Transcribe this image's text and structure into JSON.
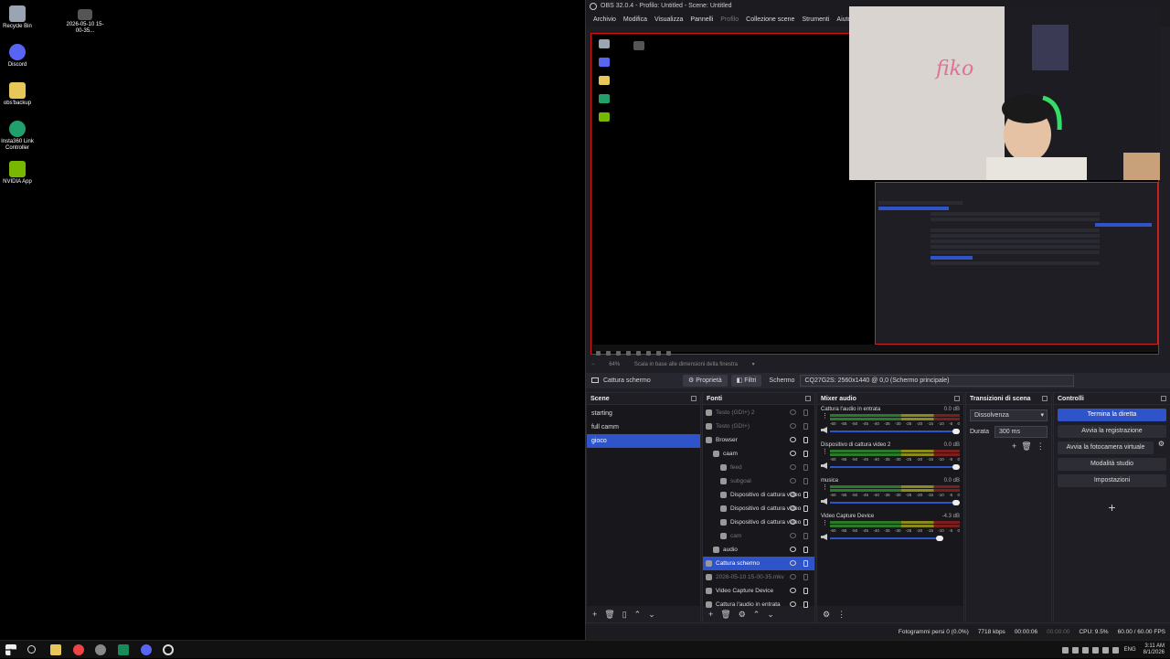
{
  "desktop": {
    "icons": [
      {
        "label": "Recycle Bin",
        "color": "#9aa4b2"
      },
      {
        "label": "Discord",
        "color": "#5865f2"
      },
      {
        "label": "obs'backup",
        "color": "#e8c75a"
      },
      {
        "label": "Insta360 Link Controller",
        "color": "#22a06b"
      },
      {
        "label": "NVIDIA App",
        "color": "#76b900"
      }
    ],
    "file_icon": {
      "label": "2026-05-10 15-00-35...",
      "color": "#555"
    }
  },
  "obs": {
    "title": "OBS 32.0.4 - Profilo: Untitled - Scene: Untitled",
    "menu": [
      "Archivio",
      "Modifica",
      "Visualizza",
      "Pannelli",
      "Profilo",
      "Collezione scene",
      "Strumenti",
      "Aiuto"
    ],
    "zoom": "64%",
    "zoom_mode": "Scala in base alle dimensioni della finestra",
    "source_bar": {
      "selected_source": "Cattura schermo",
      "properties": "Proprietà",
      "filters": "Filtri",
      "screen_label": "Schermo",
      "screen_value": "CQ27G2S: 2560x1440 @ 0,0 (Schermo principale)"
    },
    "scenes": {
      "title": "Scene",
      "items": [
        "starting",
        "full camm",
        "gioco"
      ]
    },
    "sources": {
      "title": "Fonti",
      "items": [
        {
          "label": "Testo (GDI+) 2",
          "indent": 0,
          "dim": true
        },
        {
          "label": "Testo (GDI+)",
          "indent": 0,
          "dim": true
        },
        {
          "label": "Browser",
          "indent": 0,
          "dim": false
        },
        {
          "label": "caam",
          "indent": 1,
          "dim": false
        },
        {
          "label": "feed",
          "indent": 2,
          "dim": true
        },
        {
          "label": "subgoal",
          "indent": 2,
          "dim": true
        },
        {
          "label": "Dispositivo di cattura video",
          "indent": 2,
          "dim": false
        },
        {
          "label": "Dispositivo di cattura video",
          "indent": 2,
          "dim": false
        },
        {
          "label": "Dispositivo di cattura video",
          "indent": 2,
          "dim": false
        },
        {
          "label": "cam",
          "indent": 2,
          "dim": true
        },
        {
          "label": "audio",
          "indent": 1,
          "dim": false
        },
        {
          "label": "Cattura schermo",
          "indent": 0,
          "dim": false
        },
        {
          "label": "2026-05-10 15-00-35.mkv",
          "indent": 0,
          "dim": true
        },
        {
          "label": "Video Capture Device",
          "indent": 0,
          "dim": false
        },
        {
          "label": "Cattura l'audio in entrata",
          "indent": 0,
          "dim": false
        }
      ]
    },
    "mixer": {
      "title": "Mixer audio",
      "ticks": [
        "-60",
        "-55",
        "-50",
        "-45",
        "-40",
        "-35",
        "-30",
        "-25",
        "-20",
        "-15",
        "-10",
        "-5",
        "0"
      ],
      "channels": [
        {
          "name": "Cattura l'audio in entrata",
          "db": "0.0 dB",
          "level": 1.0
        },
        {
          "name": "Dispositivo di cattura video 2",
          "db": "0.0 dB",
          "level": 1.0
        },
        {
          "name": "musica",
          "db": "0.0 dB",
          "level": 1.0
        },
        {
          "name": "Video Capture Device",
          "db": "-4.3 dB",
          "level": 0.85
        }
      ]
    },
    "transitions": {
      "title": "Transizioni di scena",
      "selected": "Dissolvenza",
      "duration_label": "Durata",
      "duration": "300 ms"
    },
    "controls": {
      "title": "Controlli",
      "buttons": [
        "Termina la diretta",
        "Avvia la registrazione",
        "Avvia la fotocamera virtuale",
        "Modalità studio",
        "Impostazioni"
      ]
    },
    "status": {
      "dropped": "Fotogrammi persi 0 (0.0%)",
      "bitrate": "7718 kbps",
      "live": "00:00:06",
      "rec": "00:00:00",
      "cpu": "CPU: 9.5%",
      "fps": "60.00 / 60.00 FPS"
    }
  },
  "taskbar": {
    "lang": "ENG",
    "time": "3:11 AM",
    "date": "8/1/2026"
  }
}
